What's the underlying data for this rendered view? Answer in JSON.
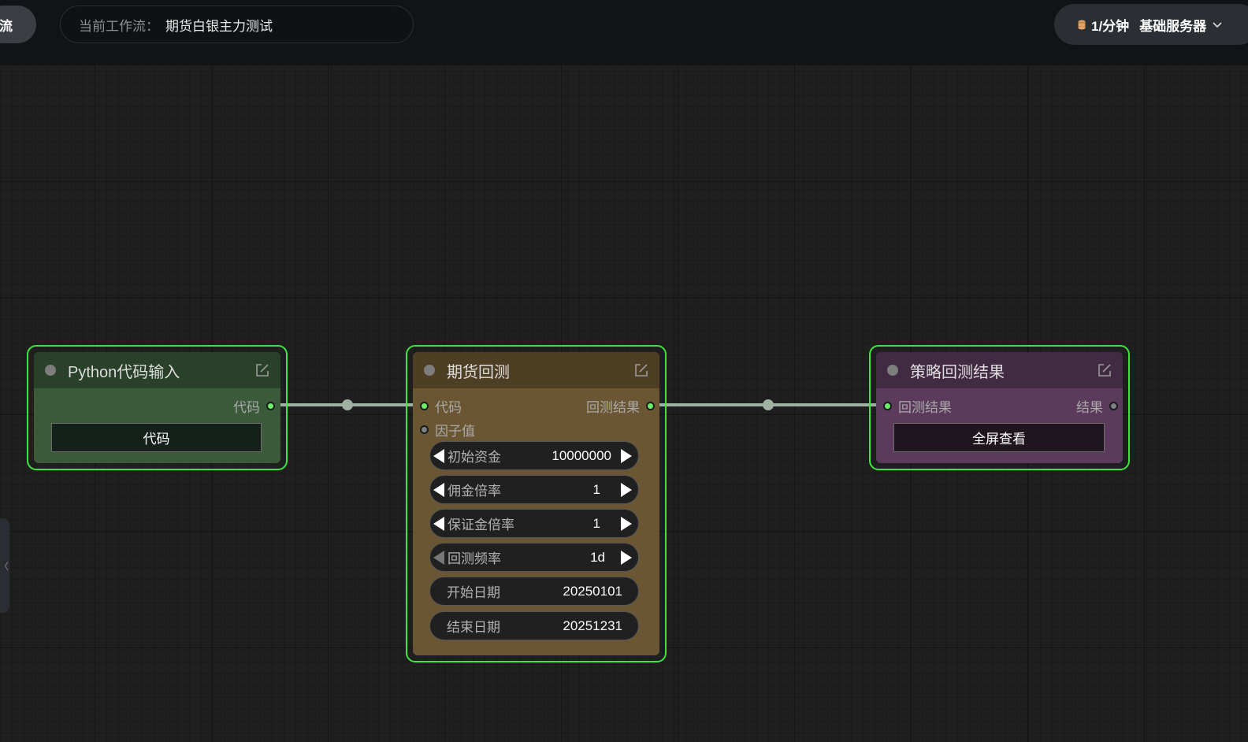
{
  "topbar": {
    "left_button": "流",
    "workflow_label": "当前工作流：",
    "workflow_name": "期货白银主力测试",
    "rate": "1/分钟",
    "server": "基础服务器"
  },
  "side_tab": {
    "glyph": "〈"
  },
  "colors": {
    "selected_border": "#3de53d",
    "port_active": "#6cf06c",
    "link": "#9fb1a1",
    "python_node": "#3a5a3a",
    "futures_node": "#6a5632",
    "result_node": "#5c3a5c"
  },
  "nodes": {
    "python": {
      "title": "Python代码输入",
      "output": "代码",
      "button": "代码"
    },
    "futures": {
      "title": "期货回测",
      "inputs": [
        "代码",
        "因子值"
      ],
      "output": "回测结果",
      "widgets": [
        {
          "label": "初始资金",
          "value": "10000000"
        },
        {
          "label": "佣金倍率",
          "value": "1"
        },
        {
          "label": "保证金倍率",
          "value": "1"
        },
        {
          "label": "回测频率",
          "value": "1d"
        },
        {
          "label": "开始日期",
          "value": "20250101"
        },
        {
          "label": "结束日期",
          "value": "20251231"
        }
      ]
    },
    "result": {
      "title": "策略回测结果",
      "input": "回测结果",
      "output": "结果",
      "button": "全屏查看"
    }
  }
}
